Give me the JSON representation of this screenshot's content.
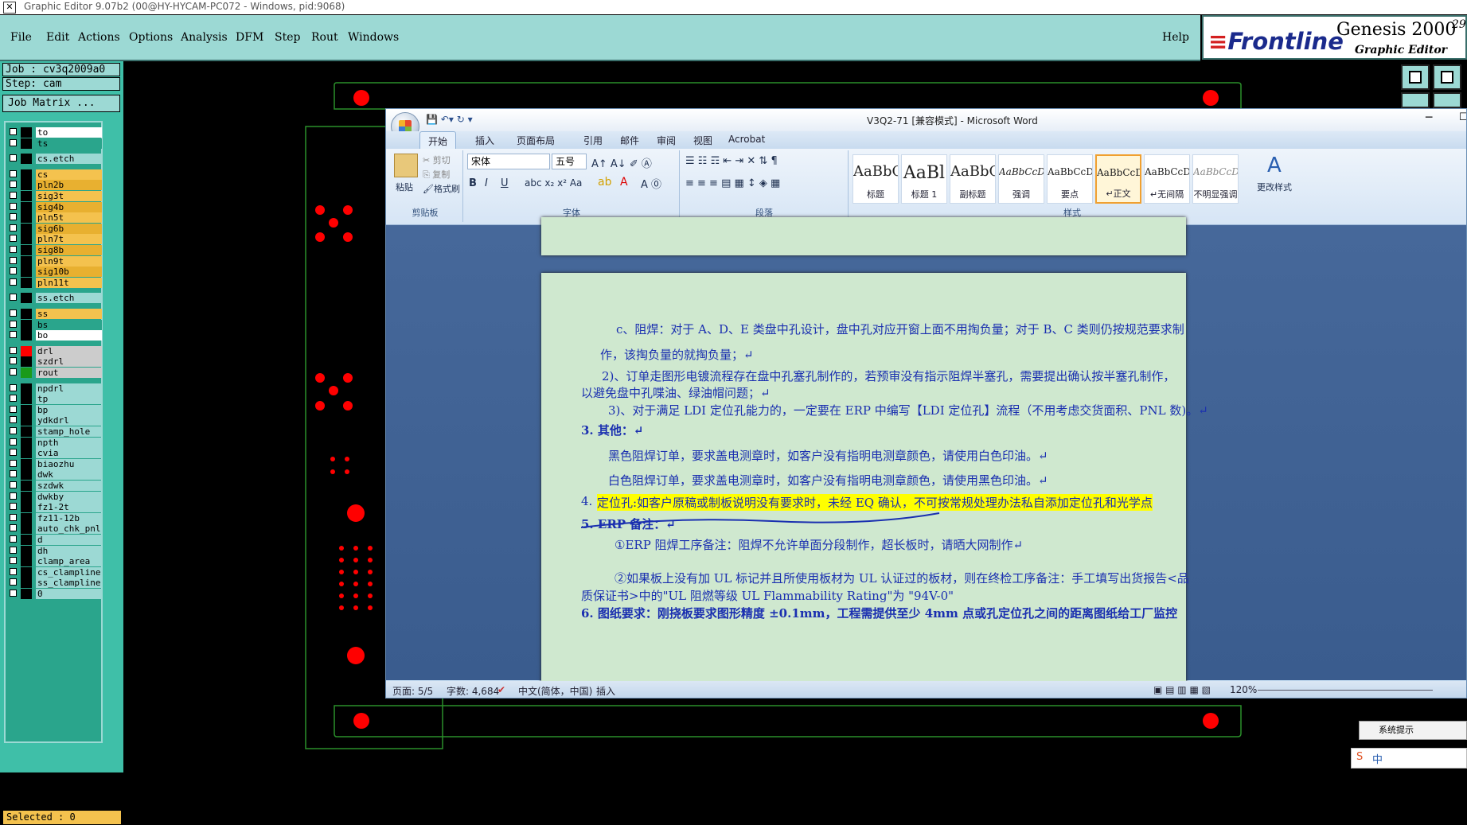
{
  "titlebar": {
    "title": "Graphic Editor 9.07b2 (00@HY-HYCAM-PC072 - Windows, pid:9068)"
  },
  "menubar": {
    "items": [
      "File",
      "Edit",
      "Actions",
      "Options",
      "Analysis",
      "DFM",
      "Step",
      "Rout",
      "Windows"
    ],
    "help": "Help"
  },
  "brand": {
    "logo": "Frontline",
    "product": "Genesis 2000",
    "version": "29",
    "subtitle": "Graphic Editor"
  },
  "job": {
    "job_line": "Job : cv3q2009a0",
    "step_line": "Step: cam",
    "matrix_label": "Job Matrix ..."
  },
  "layers": [
    {
      "name": "to",
      "color": "#ffffff"
    },
    {
      "name": "ts",
      "color": "#2aa58c"
    },
    {
      "name": "cs.etch",
      "color": "#9cd9d4"
    },
    {
      "name": "cs",
      "color": "#f4c24e"
    },
    {
      "name": "pln2b",
      "color": "#e8b030"
    },
    {
      "name": "sig3t",
      "color": "#f4c24e"
    },
    {
      "name": "sig4b",
      "color": "#e8b030"
    },
    {
      "name": "pln5t",
      "color": "#f4c24e"
    },
    {
      "name": "sig6b",
      "color": "#e8b030"
    },
    {
      "name": "pln7t",
      "color": "#f4c24e"
    },
    {
      "name": "sig8b",
      "color": "#e8b030"
    },
    {
      "name": "pln9t",
      "color": "#f4c24e"
    },
    {
      "name": "sig10b",
      "color": "#e8b030"
    },
    {
      "name": "pln11t",
      "color": "#f4c24e"
    },
    {
      "name": "ss.etch",
      "color": "#9cd9d4"
    },
    {
      "name": "ss",
      "color": "#f4c24e"
    },
    {
      "name": "bs",
      "color": "#2aa58c"
    },
    {
      "name": "bo",
      "color": "#ffffff"
    },
    {
      "name": "drl",
      "color": "#cccccc"
    },
    {
      "name": "szdrl",
      "color": "#cccccc"
    },
    {
      "name": "rout",
      "color": "#cccccc"
    },
    {
      "name": "npdrl",
      "color": "#9cd9d4"
    },
    {
      "name": "tp",
      "color": "#9cd9d4"
    },
    {
      "name": "bp",
      "color": "#9cd9d4"
    },
    {
      "name": "ydkdrl",
      "color": "#9cd9d4"
    },
    {
      "name": "stamp_hole",
      "color": "#9cd9d4"
    },
    {
      "name": "npth",
      "color": "#9cd9d4"
    },
    {
      "name": "cvia",
      "color": "#9cd9d4"
    },
    {
      "name": "biaozhu",
      "color": "#9cd9d4"
    },
    {
      "name": "dwk",
      "color": "#9cd9d4"
    },
    {
      "name": "szdwk",
      "color": "#9cd9d4"
    },
    {
      "name": "dwkby",
      "color": "#9cd9d4"
    },
    {
      "name": "fz1-2t",
      "color": "#9cd9d4"
    },
    {
      "name": "fz11-12b",
      "color": "#9cd9d4"
    },
    {
      "name": "auto_chk_pnl",
      "color": "#9cd9d4"
    },
    {
      "name": "d",
      "color": "#9cd9d4"
    },
    {
      "name": "dh",
      "color": "#9cd9d4"
    },
    {
      "name": "clamp_area",
      "color": "#9cd9d4"
    },
    {
      "name": "cs_clampline",
      "color": "#9cd9d4"
    },
    {
      "name": "ss_clampline",
      "color": "#9cd9d4"
    },
    {
      "name": "0",
      "color": "#9cd9d4"
    }
  ],
  "selected": "Selected : 0",
  "word": {
    "title": "V3Q2-71 [兼容模式] - Microsoft Word",
    "tabs": [
      "开始",
      "插入",
      "页面布局",
      "引用",
      "邮件",
      "审阅",
      "视图",
      "Acrobat"
    ],
    "clipboard": {
      "paste": "粘贴",
      "cut": "剪切",
      "copy": "复制",
      "painter": "格式刷",
      "label": "剪贴板"
    },
    "font": {
      "name": "宋体",
      "size": "五号",
      "label": "字体"
    },
    "paragraph_label": "段落",
    "styles": [
      {
        "preview": "AaBbC",
        "name": "标题"
      },
      {
        "preview": "AaBl",
        "name": "标题 1"
      },
      {
        "preview": "AaBbC",
        "name": "副标题"
      },
      {
        "preview": "AaBbCcDd",
        "name": "强调"
      },
      {
        "preview": "AaBbCcD",
        "name": "要点"
      },
      {
        "preview": "AaBbCcDd",
        "name": "↵正文"
      },
      {
        "preview": "AaBbCcDd",
        "name": "↵无间隔"
      },
      {
        "preview": "AaBbCcDd",
        "name": "不明显强调"
      }
    ],
    "change_styles": "更改样式",
    "styles_label": "样式",
    "doc": {
      "p1": "c、阻焊：对于 A、D、E 类盘中孔设计，盘中孔对应开窗上面不用掏负量；对于 B、C 类则仍按规范要求制",
      "p1b": "作，该掏负量的就掏负量；↵",
      "p2": "2)、订单走图形电镀流程存在盘中孔塞孔制作的，若预审没有指示阻焊半塞孔，需要提出确认按半塞孔制作，",
      "p2b": "以避免盘中孔喋油、绿油帽问题；↵",
      "p3": "3)、对于满足 LDI 定位孔能力的，一定要在 ERP 中编写【LDI 定位孔】流程（不用考虑交货面积、PNL 数)。↵",
      "h3": "3. 其他：↵",
      "p4": "黑色阻焊订单，要求盖电测章时，如客户没有指明电测章颜色，请使用白色印油。↵",
      "p5": "白色阻焊订单，要求盖电测章时，如客户没有指明电测章颜色，请使用黑色印油。↵",
      "h4": "4. ",
      "h4b": "定位孔:如客户原稿或制板说明没有要求时，未经 EQ 确认，不可按常规处理办法私自添加定位孔和光学点",
      "h5": "5. ERP 备注：↵",
      "p6": "①ERP 阻焊工序备注：阻焊不允许单面分段制作，超长板时，请晒大网制作↵",
      "p7": "②如果板上没有加 UL 标记并且所使用板材为 UL 认证过的板材，则在终检工序备注：手工填写出货报告<品",
      "p7b": "质保证书>中的\"UL 阻燃等级 UL Flammability Rating\"为 \"94V-0\"",
      "p8": "6. 图纸要求：刚挠板要求图形精度 ±0.1mm，工程需提供至少 4mm 点或孔定位孔之间的距离图纸给工厂监控"
    },
    "status": {
      "page": "页面: 5/5",
      "words": "字数: 4,684",
      "lang": "中文(简体，中国)",
      "mode": "插入",
      "zoom": "120%"
    }
  },
  "popup": {
    "title": "系统提示",
    "ime": "中"
  }
}
